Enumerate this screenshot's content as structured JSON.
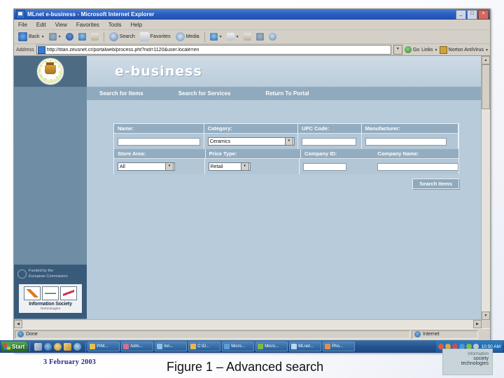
{
  "window": {
    "title": "MLnet e-business - Microsoft Internet Explorer",
    "minimize": "_",
    "maximize": "□",
    "close": "×"
  },
  "menu": [
    "File",
    "Edit",
    "View",
    "Favorites",
    "Tools",
    "Help"
  ],
  "toolbar": {
    "back": "Back",
    "forward": "",
    "stop": "",
    "refresh": "",
    "home": "",
    "search": "Search",
    "favorites": "Favorites",
    "media": "Media",
    "dropdown_caret": "▾"
  },
  "address": {
    "label": "Address",
    "url": "http://titan.zeusnet.cr/portalweb/process.pht?nid=1120&user.locale=en",
    "caret": "▾",
    "go": "Go",
    "links": "Links",
    "norton": "Norton AntiVirus"
  },
  "page": {
    "brand": "e-business",
    "nav": [
      {
        "label": "Search for Items"
      },
      {
        "label": "Search for Services"
      },
      {
        "label": "Return To Portal"
      }
    ],
    "form": {
      "row1": [
        {
          "label": "Name:",
          "type": "text",
          "value": "",
          "width": 124
        },
        {
          "label": "Category:",
          "type": "select",
          "value": "Ceramics",
          "width": 124
        },
        {
          "label": "UPC Code:",
          "type": "text",
          "value": "",
          "width": 78
        },
        {
          "label": "Manufacturer:",
          "type": "text",
          "value": "",
          "width": 112
        }
      ],
      "row2": [
        {
          "label": "Store  Area:",
          "type": "select",
          "value": "All",
          "width": 80
        },
        {
          "label": "Price Type:",
          "type": "select",
          "value": "Retail",
          "width": 58
        },
        {
          "label": "Company ID:",
          "type": "text",
          "value": "",
          "width": 62
        },
        {
          "label": "Company Name:",
          "type": "text",
          "value": "",
          "width": 116
        }
      ],
      "submit": "Search Items"
    },
    "funding": {
      "line1": "Funded by the",
      "line2": "European Commission",
      "logo_title": "Information Society",
      "logo_sub": "Technologies"
    }
  },
  "status": {
    "message": "Done",
    "zone": "Internet"
  },
  "taskbar": {
    "start": "Start",
    "buttons": [
      {
        "label": "PrM..."
      },
      {
        "label": "Adm..."
      },
      {
        "label": "Inn..."
      },
      {
        "label": "C:\\D..."
      },
      {
        "label": "Micro..."
      },
      {
        "label": "Micro..."
      },
      {
        "label": "MLnet..."
      },
      {
        "label": "Pho..."
      }
    ],
    "clock": "10:50 AM"
  },
  "slide": {
    "date": "3 February  2003",
    "caption": "Figure 1 – Advanced search",
    "badge_l1": "information",
    "badge_l2": "society",
    "badge_l3": "technologies"
  },
  "colors": {
    "title_blue": "#2b5fc0",
    "sidebar": "#6f8da4",
    "content": "#b7cbda",
    "nav": "#8fa9bd",
    "label": "#93acc0",
    "funding": "#3a5a7a",
    "date_text": "#202880"
  }
}
